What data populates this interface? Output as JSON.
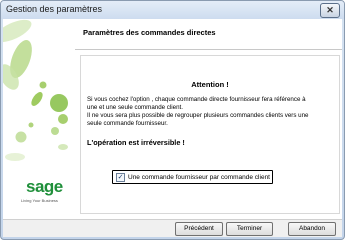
{
  "window": {
    "title": "Gestion des paramètres",
    "close_glyph": "✕"
  },
  "sidebar": {
    "brand": "sage",
    "tagline": "Living Your Business"
  },
  "header": {
    "title": "Paramètres des commandes directes"
  },
  "content": {
    "attention": "Attention !",
    "body_lines": [
      "Si vous cochez l'option , chaque commande directe fournisseur fera référence à",
      "une et une seule commande client.",
      "Il ne vous sera plus possible de regrouper plusieurs commandes clients vers une",
      "seule commande fournisseur."
    ],
    "warning": "L'opération est irréversible !",
    "checkbox": {
      "label": "Une commande fournisseur par commande client",
      "checked": true,
      "glyph": "✓"
    }
  },
  "footer": {
    "previous_label": "Précédent",
    "finish_label": "Terminer",
    "cancel_label": "Abandon"
  },
  "colors": {
    "brand_green": "#1f8f3a",
    "leaf_light": "#b9d98b",
    "leaf_mid": "#8cc24f"
  }
}
